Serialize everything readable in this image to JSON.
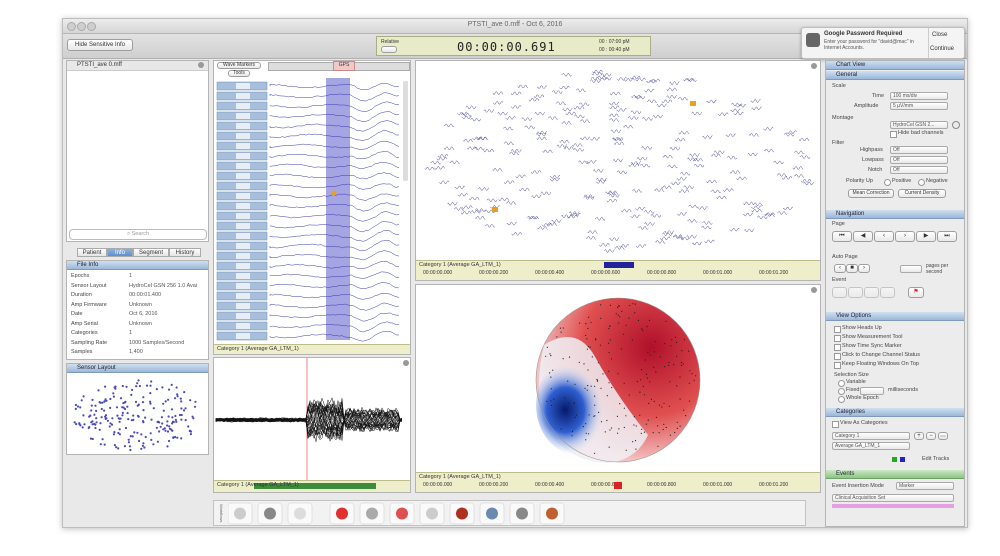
{
  "window": {
    "title": "PTSTI_ave 0.mff - Oct 6, 2016"
  },
  "toolbar": {
    "hide_sensitive_label": "Hide Sensitive Info",
    "timer_label": "Relative",
    "timer": "00:00:00.691",
    "time_right_1": "00 : 07:00 pM",
    "time_right_2": "00 : 00:40 pM"
  },
  "notification": {
    "title": "Google Password Required",
    "body": "Enter your password for \"david@mac\" in Internet Accounts.",
    "close": "Close",
    "continue": "Continue"
  },
  "left": {
    "file_name": "PTSTI_ave 0.mff",
    "search_placeholder": "Search",
    "tabs": [
      "Patient",
      "Info",
      "Segment",
      "History"
    ],
    "file_info_header": "File Info",
    "info_rows": [
      {
        "label": "Epochs",
        "value": "1"
      },
      {
        "label": "Sensor Layout",
        "value": "HydroCel GSN 256 1.0 Avai"
      },
      {
        "label": "Duration",
        "value": "00:00:01.400"
      },
      {
        "label": "Amp Firmware",
        "value": "Unknown"
      },
      {
        "label": "Date",
        "value": "Oct 6, 2016"
      },
      {
        "label": "Amp Serial",
        "value": "Unknown"
      },
      {
        "label": "Categories",
        "value": "1"
      },
      {
        "label": "Sampling Rate",
        "value": "1000 Samples/Second"
      },
      {
        "label": "Samples",
        "value": "1,400"
      }
    ],
    "sensor_layout_header": "Sensor Layout"
  },
  "center": {
    "wave_tab": "Wave Markers",
    "sub_tab": "Tools",
    "marker_label": "GPS",
    "channel_status": "Category 1 (Average GA_LTM_1)",
    "butterfly_status": "Category 1 (Average GA_LTM_1)"
  },
  "topo": {
    "status": "Category 1 (Average GA_LTM_1)",
    "timeline": [
      "00:00:00.000",
      "00:00:00.200",
      "00:00:00.400",
      "00:00:00.600",
      "00:00:00.800",
      "00:00:01.000",
      "00:00:01.200"
    ]
  },
  "map": {
    "status": "Category 1 (Average GA_LTM_1)",
    "timeline": [
      "00:00:00.000",
      "00:00:00.200",
      "00:00:00.400",
      "00:00:00.600",
      "00:00:00.800",
      "00:00:01.000",
      "00:00:01.200"
    ]
  },
  "right": {
    "header": "Chart View",
    "general": "General",
    "scale_label": "Scale",
    "time_label": "Time",
    "time_value": "100 ms/div",
    "amplitude_label": "Amplitude",
    "amplitude_value": "5 µV/mm",
    "montage_label": "Montage",
    "montage_value": "HydroCel GSN 2...",
    "hide_bad": "Hide bad channels",
    "filter_label": "Filter",
    "highpass_label": "Highpass",
    "highpass_value": "Off",
    "lowpass_label": "Lowpass",
    "lowpass_value": "Off",
    "notch_label": "Notch",
    "notch_value": "Off",
    "polarity_label": "Polarity Up",
    "positive": "Positive",
    "negative": "Negative",
    "mean_correction": "Mean Correction",
    "current_density": "Current Density",
    "navigation": "Navigation",
    "page_label": "Page",
    "auto_page": "Auto Page",
    "pages_per_second": "pages per second",
    "event_label": "Event",
    "view_options": "View Options",
    "view_opts": [
      "Show Heads Up",
      "Show Measurement Tool",
      "Show Time Sync Marker",
      "Click to Change Channel Status",
      "Keep Floating Windows On Top"
    ],
    "selection_size": "Selection Size",
    "variable": "Variable",
    "fixed": "Fixed",
    "milliseconds": "milliseconds",
    "whole_epoch": "Whole Epoch",
    "categories_header": "Categories",
    "view_as_categories": "View As Categories",
    "category_value": "Category 1",
    "average_value": "Average GA_LTM_1",
    "edit_tracks": "Edit Tracks",
    "events_header": "Events",
    "event_insertion_mode": "Event Insertion Mode",
    "marker_value": "Marker",
    "clinical_value": "Clinical Acquisition Set"
  },
  "dock": {
    "label": "Workflows"
  }
}
